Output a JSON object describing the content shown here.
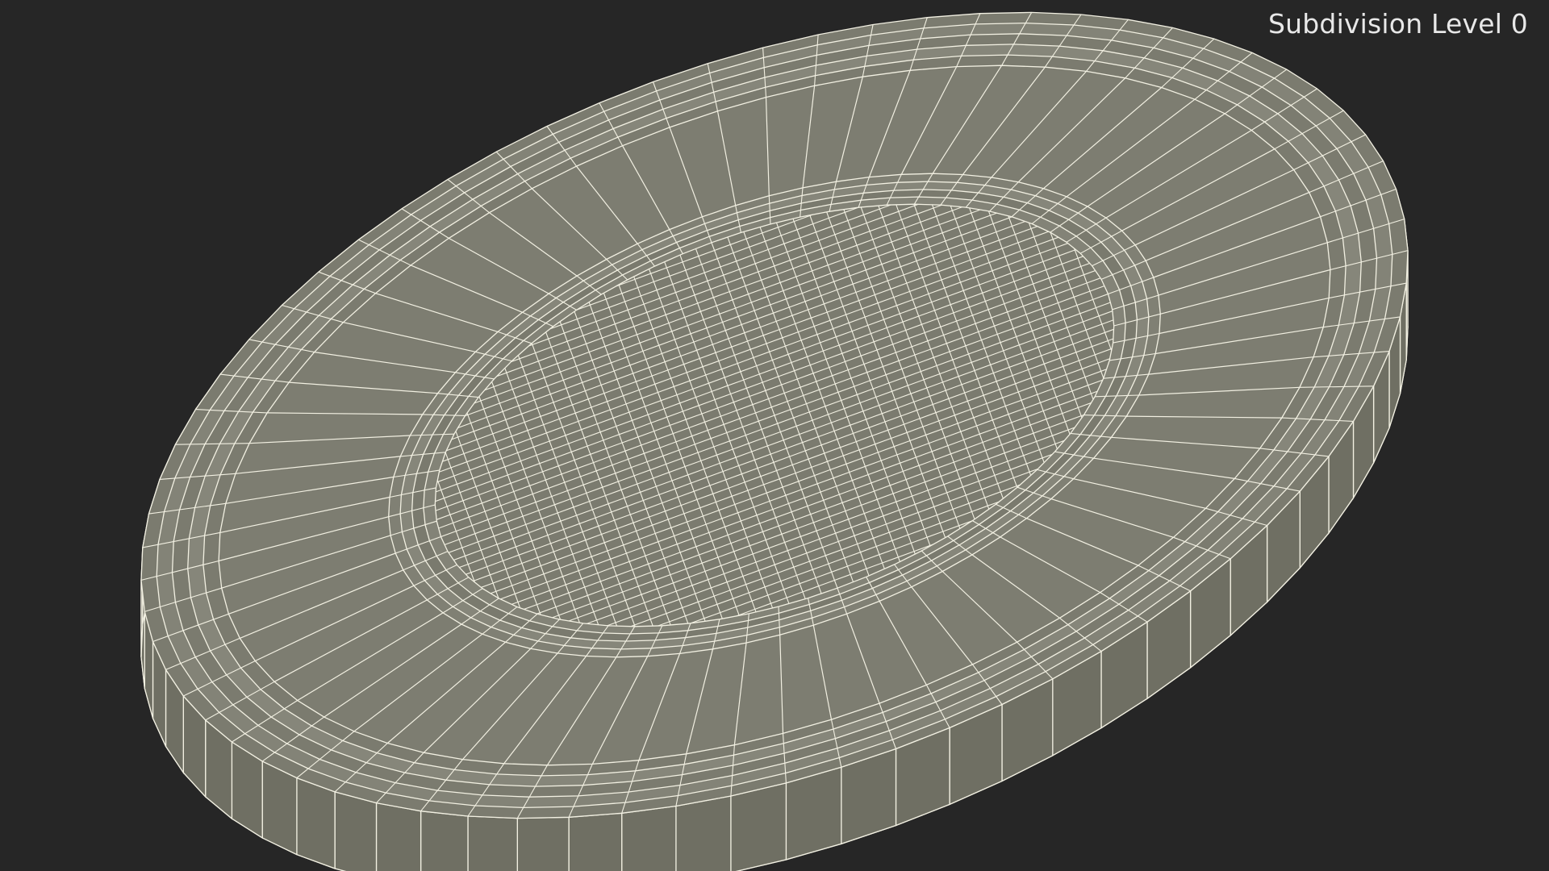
{
  "viewport": {
    "label": "Subdivision Level 0",
    "background_color": "#262626",
    "label_color": "#e8e8e8"
  },
  "model": {
    "display_mode": "wireframe-on-shaded",
    "surface_color": "#7b7b6f",
    "wire_color": "#f2f0e2",
    "shadow_color": "#4a4a42"
  }
}
